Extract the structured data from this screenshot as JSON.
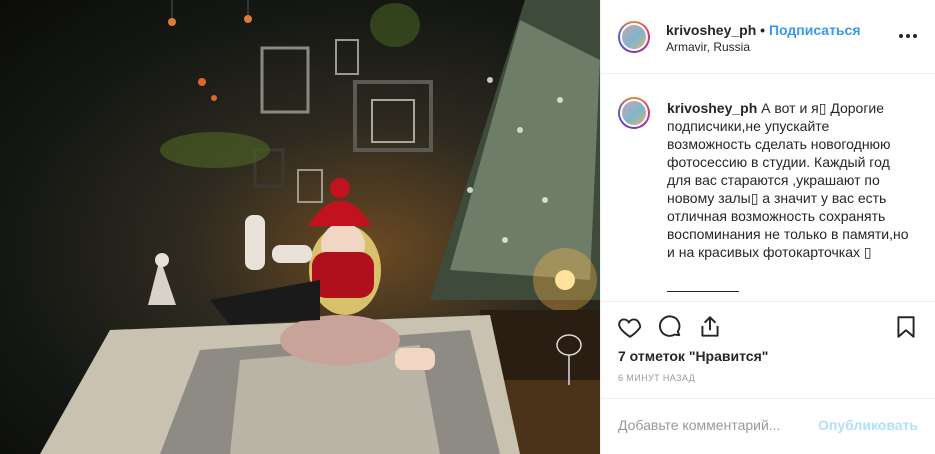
{
  "post": {
    "image_alt": "Girl in red hat lying on a bed near a Christmas tree in a studio",
    "header": {
      "username": "krivoshey_ph",
      "separator": "•",
      "follow_label": "Подписаться",
      "location": "Armavir, Russia",
      "more_icon": "more-horizontal-icon"
    },
    "caption": {
      "username": "krivoshey_ph",
      "text": "А вот и я▯ Дорогие подписчики,не упускайте возможность сделать новогоднюю фотосессию в студии. Каждый год для вас стараются ,украшают по новому залы▯ а значит у вас есть отличная возможность сохранять воспоминания не только в памяти,но и на красивых фотокарточках ▯"
    },
    "actions": {
      "like_icon": "heart-icon",
      "comment_icon": "comment-icon",
      "share_icon": "share-icon",
      "save_icon": "bookmark-icon"
    },
    "likes_text": "7 отметок \"Нравится\"",
    "time_text": "6 МИНУТ НАЗАД",
    "comment_box": {
      "placeholder": "Добавьте комментарий...",
      "post_label": "Опубликовать"
    }
  },
  "colors": {
    "link_blue": "#3897f0",
    "post_disabled": "#b2dffc",
    "muted": "#999999",
    "border": "#efefef"
  }
}
